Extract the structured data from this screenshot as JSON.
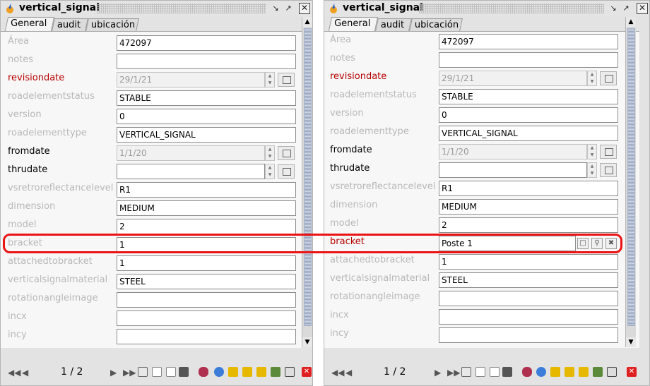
{
  "left": {
    "title": "vertical_signal",
    "tabs": [
      "General",
      "audit",
      "ubicación"
    ],
    "fields": [
      {
        "label": "Área",
        "value": "472097"
      },
      {
        "label": "notes",
        "value": ""
      },
      {
        "label": "revisiondate",
        "value": "29/1/21"
      },
      {
        "label": "roadelementstatus",
        "value": "STABLE"
      },
      {
        "label": "version",
        "value": "0"
      },
      {
        "label": "roadelementtype",
        "value": "VERTICAL_SIGNAL"
      },
      {
        "label": "fromdate",
        "value": "1/1/20"
      },
      {
        "label": "thrudate",
        "value": ""
      },
      {
        "label": "vsretroreflectancelevel",
        "value": "R1"
      },
      {
        "label": "dimension",
        "value": "MEDIUM"
      },
      {
        "label": "model",
        "value": "2"
      },
      {
        "label": "bracket",
        "value": "1"
      },
      {
        "label": "attachedtobracket",
        "value": "1"
      },
      {
        "label": "verticalsignalmaterial",
        "value": "STEEL"
      },
      {
        "label": "rotationangleimage",
        "value": ""
      },
      {
        "label": "incx",
        "value": ""
      },
      {
        "label": "incy",
        "value": ""
      }
    ],
    "page_indicator": "1 / 2"
  },
  "right": {
    "title": "vertical_signal",
    "tabs": [
      "General",
      "audit",
      "ubicación"
    ],
    "fields": [
      {
        "label": "Área",
        "value": "472097"
      },
      {
        "label": "notes",
        "value": ""
      },
      {
        "label": "revisiondate",
        "value": "29/1/21"
      },
      {
        "label": "roadelementstatus",
        "value": "STABLE"
      },
      {
        "label": "version",
        "value": "0"
      },
      {
        "label": "roadelementtype",
        "value": "VERTICAL_SIGNAL"
      },
      {
        "label": "fromdate",
        "value": "1/1/20"
      },
      {
        "label": "thrudate",
        "value": ""
      },
      {
        "label": "vsretroreflectancelevel",
        "value": "R1"
      },
      {
        "label": "dimension",
        "value": "MEDIUM"
      },
      {
        "label": "model",
        "value": "2"
      },
      {
        "label": "bracket",
        "value": "Poste 1"
      },
      {
        "label": "attachedtobracket",
        "value": "1"
      },
      {
        "label": "verticalsignalmaterial",
        "value": "STEEL"
      },
      {
        "label": "rotationangleimage",
        "value": ""
      },
      {
        "label": "incx",
        "value": ""
      },
      {
        "label": "incy",
        "value": ""
      }
    ],
    "page_indicator": "1 / 2"
  },
  "colors": {
    "required_label": "#b70000",
    "disabled_label": "#b8b8b8",
    "highlight": "#ea1414"
  }
}
